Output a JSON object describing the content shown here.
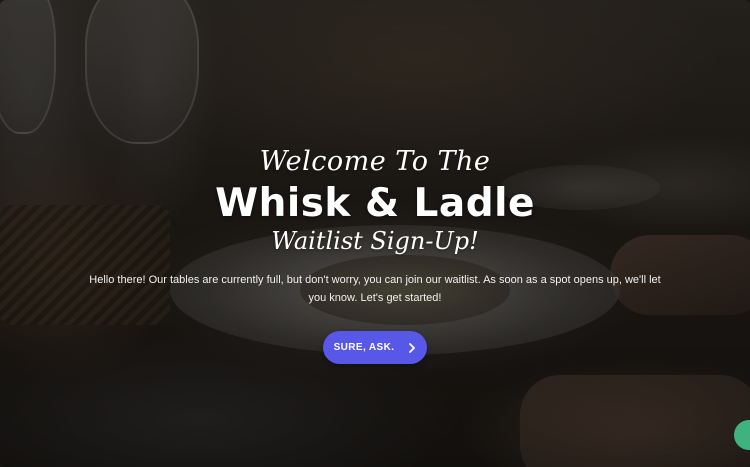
{
  "hero": {
    "welcome_line": "Welcome To The",
    "brand_name": "Whisk & Ladle",
    "subtitle": "Waitlist Sign-Up!",
    "intro_text": "Hello there! Our tables are currently full, but don't worry, you can join our waitlist. As soon as a spot opens up, we'll let you know. Let's get started!"
  },
  "cta": {
    "label": "SURE, ASK.",
    "icon": "chevron-right-icon",
    "color": "#5757e8"
  },
  "chat_widget": {
    "icon": "chat-icon",
    "color": "#3fb37f"
  }
}
